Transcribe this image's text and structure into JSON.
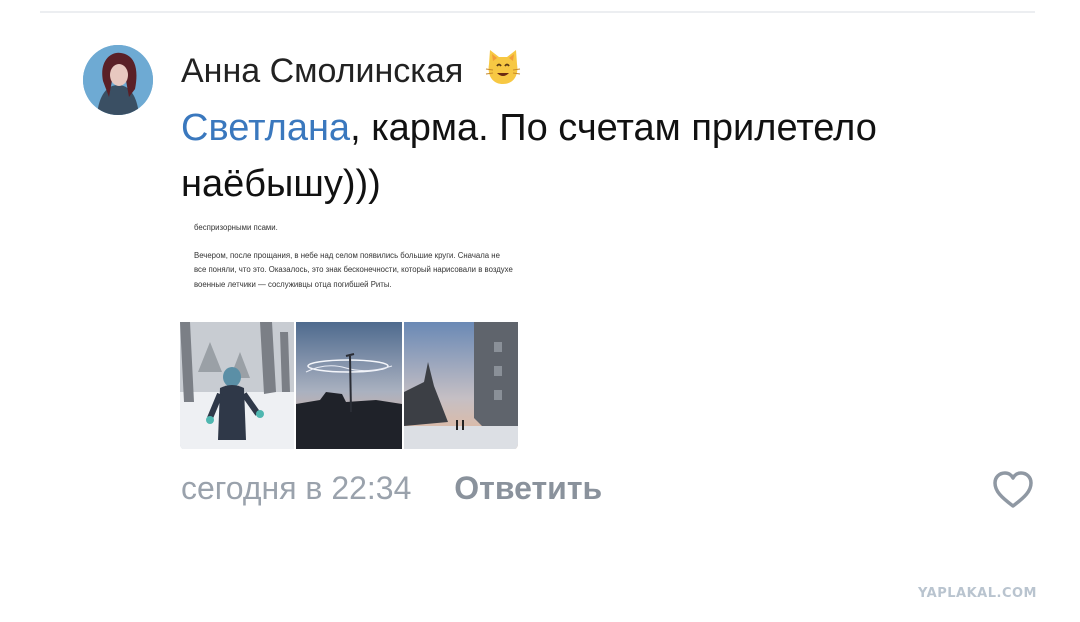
{
  "comment": {
    "author_name": "Анна Смолинская",
    "mention": "Светлана",
    "text": ",  карма.  По счетам прилетело наёбышу)))",
    "timestamp": "сегодня в 22:34",
    "reply_label": "Ответить"
  },
  "attachment": {
    "paragraphs": [
      "беспризорными псами.",
      "Вечером, после прощания, в небе над селом появились большие круги. Сначала не все поняли, что это. Оказалось, это знак бесконечности, который нарисовали в воздухе военные летчики — сослуживцы отца погибшей Риты."
    ],
    "photos": [
      "child-in-snow",
      "sky-infinity-trail",
      "street-dusk"
    ]
  },
  "icons": {
    "author_badge": "cat-emoji-icon",
    "like": "heart-icon"
  },
  "watermark": "YAPLAKAL.COM",
  "colors": {
    "mention": "#3a78be",
    "meta": "#9aa2ac",
    "reply": "#8a929c",
    "watermark": "#b9c4cf"
  }
}
